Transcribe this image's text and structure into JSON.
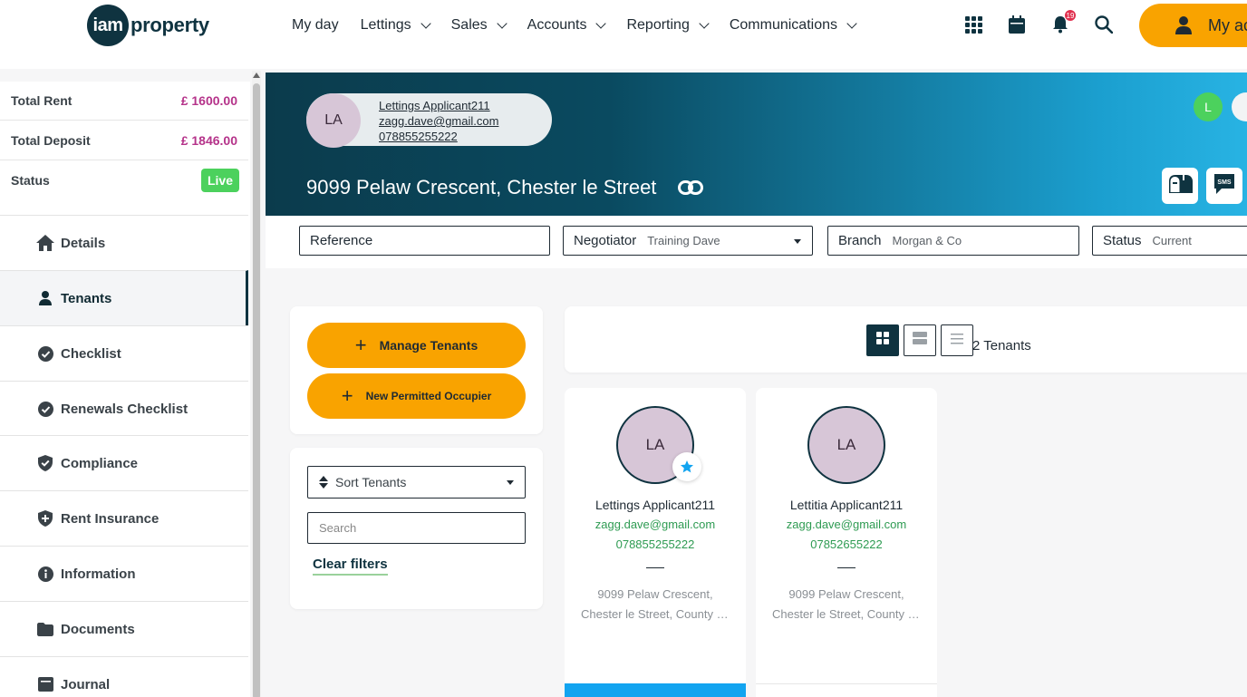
{
  "nav": {
    "logo_mark": "iam",
    "logo_word": "property",
    "menu": [
      {
        "label": "My day",
        "dropdown": false
      },
      {
        "label": "Lettings",
        "dropdown": true
      },
      {
        "label": "Sales",
        "dropdown": true
      },
      {
        "label": "Accounts",
        "dropdown": true
      },
      {
        "label": "Reporting",
        "dropdown": true
      },
      {
        "label": "Communications",
        "dropdown": true
      }
    ],
    "notification_count": "19",
    "my_account_label": "My ac"
  },
  "summary": {
    "total_rent_label": "Total Rent",
    "total_rent_value": "£ 1600.00",
    "total_deposit_label": "Total Deposit",
    "total_deposit_value": "£ 1846.00",
    "status_label": "Status",
    "status_value": "Live"
  },
  "sidebar": {
    "items": [
      {
        "label": "Details",
        "icon": "home-icon"
      },
      {
        "label": "Tenants",
        "icon": "person-icon",
        "active": true
      },
      {
        "label": "Checklist",
        "icon": "check-circle-icon"
      },
      {
        "label": "Renewals Checklist",
        "icon": "check-circle-icon"
      },
      {
        "label": "Compliance",
        "icon": "shield-check-icon"
      },
      {
        "label": "Rent Insurance",
        "icon": "shield-plus-icon"
      },
      {
        "label": "Information",
        "icon": "info-icon"
      },
      {
        "label": "Documents",
        "icon": "folder-icon"
      },
      {
        "label": "Journal",
        "icon": "journal-icon"
      }
    ]
  },
  "header": {
    "tenant_initials": "LA",
    "tenant_name": "Lettings Applicant211",
    "tenant_email": "zagg.dave@gmail.com",
    "tenant_phone": "078855255222",
    "address": "9099 Pelaw Crescent, Chester le Street",
    "user_initial": "L"
  },
  "filters": {
    "reference_label": "Reference",
    "negotiator_label": "Negotiator",
    "negotiator_value": "Training Dave",
    "branch_label": "Branch",
    "branch_value": "Morgan & Co",
    "status_label": "Status",
    "status_value": "Current"
  },
  "actions": {
    "manage_tenants": "Manage Tenants",
    "new_occupier": "New Permitted Occupier",
    "sort_label": "Sort Tenants",
    "search_placeholder": "Search",
    "clear_filters": "Clear filters"
  },
  "list": {
    "count_label": "2 Tenants"
  },
  "tenants": [
    {
      "initials": "LA",
      "name": "Lettings Applicant211",
      "email": "zagg.dave@gmail.com",
      "phone": "078855255222",
      "address_line1": "9099 Pelaw Crescent,",
      "address_line2": "Chester le Street, County Durham",
      "lead": true
    },
    {
      "initials": "LA",
      "name": "Lettitia Applicant211",
      "email": "zagg.dave@gmail.com",
      "phone": "07852655222",
      "address_line1": "9099 Pelaw Crescent,",
      "address_line2": "Chester le Street, County Durham",
      "lead": false
    }
  ],
  "colors": {
    "brand_dark": "#0f3340",
    "accent_orange": "#f9a300",
    "live_green": "#4cd15d",
    "money_magenta": "#b5338a",
    "contact_green": "#2e9b52",
    "lead_blue": "#12a4f0"
  }
}
